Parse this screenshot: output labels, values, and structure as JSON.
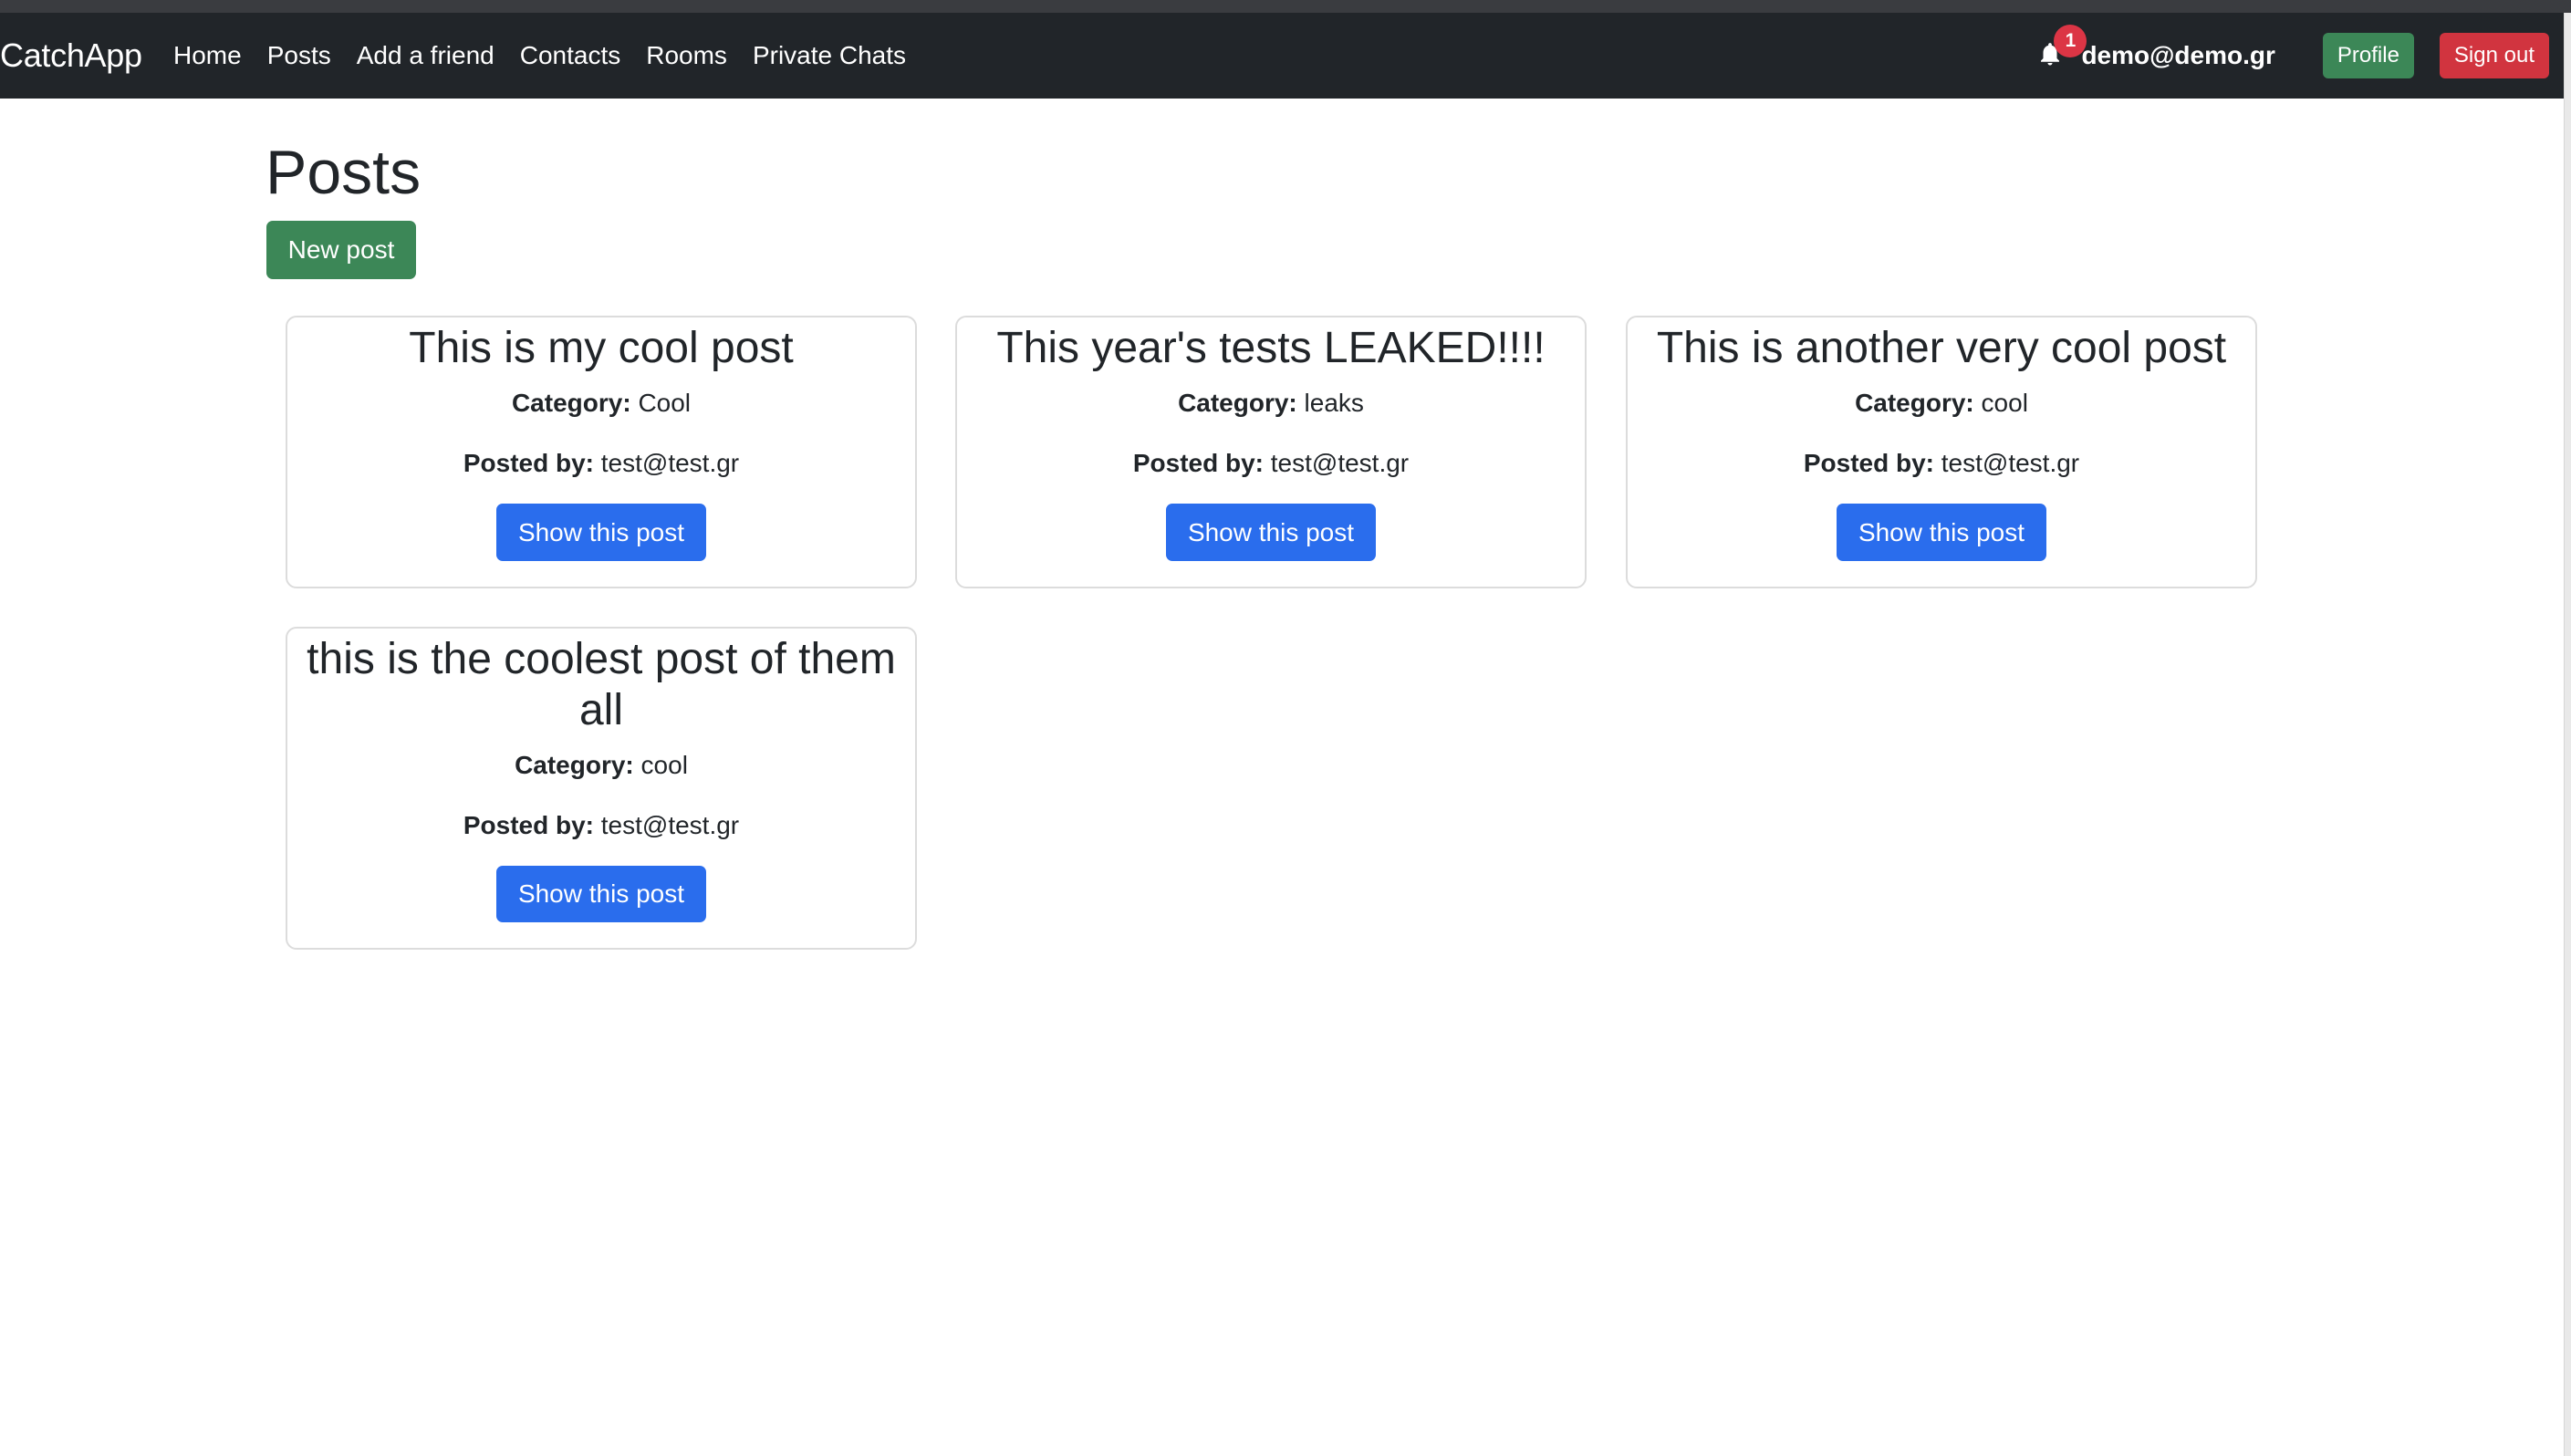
{
  "navbar": {
    "brand": "CatchApp",
    "links": [
      "Home",
      "Posts",
      "Add a friend",
      "Contacts",
      "Rooms",
      "Private Chats"
    ],
    "notification_count": "1",
    "user_email": "demo@demo.gr",
    "profile_label": "Profile",
    "signout_label": "Sign out",
    "icons": {
      "notifications": "bell-icon"
    }
  },
  "page": {
    "title": "Posts",
    "new_post_label": "New post"
  },
  "field_labels": {
    "category": "Category:",
    "posted_by": "Posted by:"
  },
  "posts": [
    {
      "title": "This is my cool post",
      "category": "Cool",
      "posted_by": "test@test.gr",
      "button": "Show this post"
    },
    {
      "title": "This year's tests LEAKED!!!!",
      "category": "leaks",
      "posted_by": "test@test.gr",
      "button": "Show this post"
    },
    {
      "title": "This is another very cool post",
      "category": "cool",
      "posted_by": "test@test.gr",
      "button": "Show this post"
    },
    {
      "title": "this is the coolest post of them all",
      "category": "cool",
      "posted_by": "test@test.gr",
      "button": "Show this post"
    }
  ],
  "colors": {
    "navbar_bg": "#212529",
    "success": "#3c8757",
    "danger": "#d1343f",
    "primary": "#2a6ded",
    "badge": "#dc3545"
  }
}
